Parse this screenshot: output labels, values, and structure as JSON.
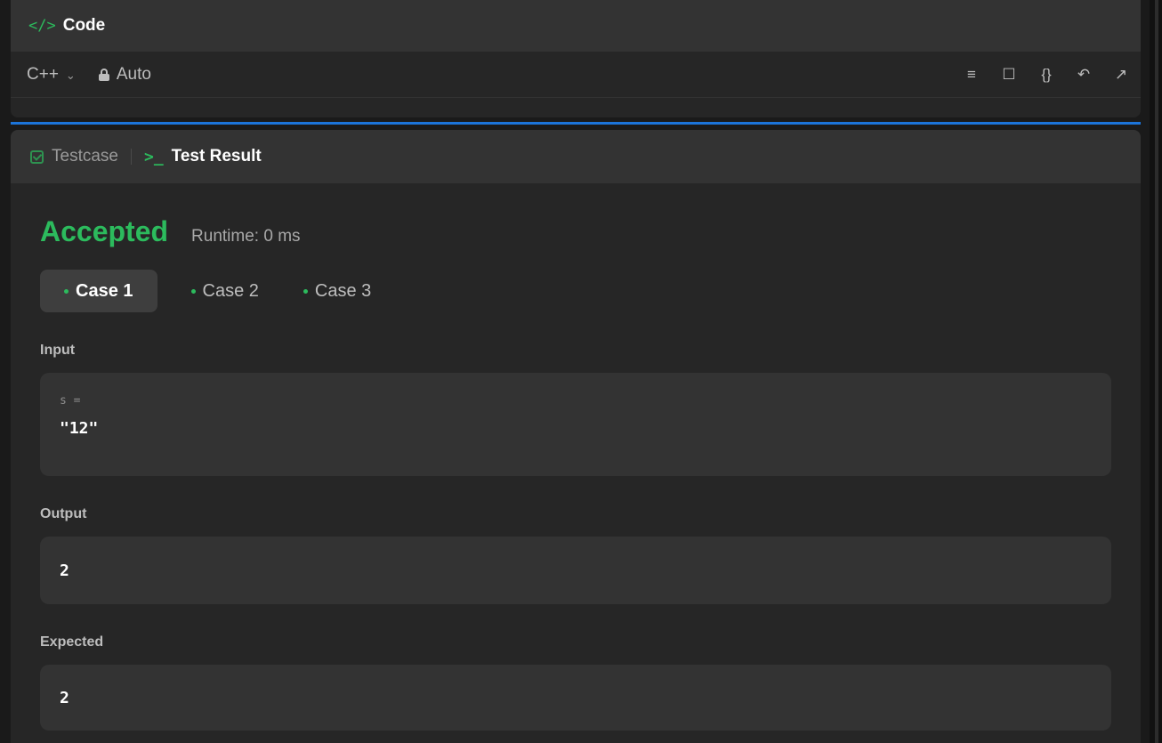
{
  "code_panel": {
    "icon": "code-icon",
    "title": "Code",
    "language": "C++",
    "mode": "Auto",
    "toolbar_icons": [
      "format-icon",
      "bookmark-icon",
      "braces-icon",
      "reset-icon",
      "expand-icon"
    ]
  },
  "result_panel": {
    "tabs": {
      "testcase": "Testcase",
      "test_result": "Test Result"
    },
    "status": "Accepted",
    "runtime": "Runtime: 0 ms",
    "cases": [
      "Case 1",
      "Case 2",
      "Case 3"
    ],
    "active_case": "Case 1",
    "input_label": "Input",
    "input_var": "s =",
    "input_value": "\"12\"",
    "output_label": "Output",
    "output_value": "2",
    "expected_label": "Expected",
    "expected_value": "2"
  },
  "colors": {
    "accent_green": "#2cbb5d",
    "divider_blue": "#1c74d9",
    "panel_bg": "#262626",
    "header_bg": "#333333"
  }
}
